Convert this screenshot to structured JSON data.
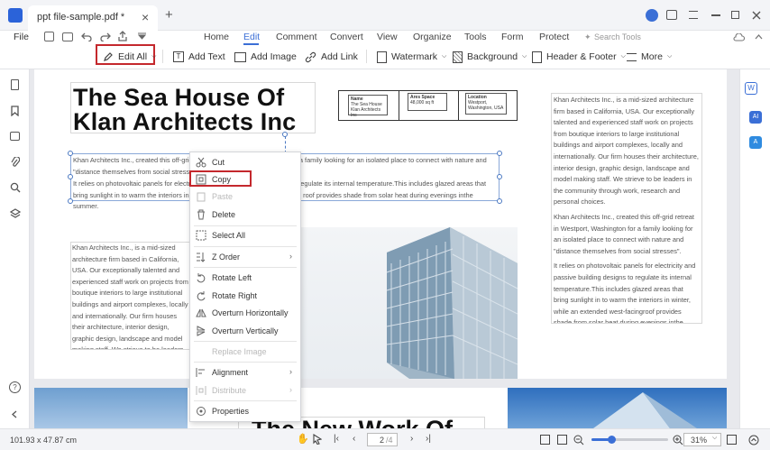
{
  "tab": {
    "title": "ppt file-sample.pdf *",
    "close": "×",
    "new": "+"
  },
  "menu": {
    "file": "File",
    "tabs": [
      "Home",
      "Edit",
      "Comment",
      "Convert",
      "View",
      "Organize",
      "Tools",
      "Form",
      "Protect"
    ],
    "search_placeholder": "Search Tools"
  },
  "toolbar": {
    "edit_all": "Edit All",
    "add_text": "Add Text",
    "add_image": "Add Image",
    "add_link": "Add Link",
    "watermark": "Watermark",
    "background": "Background",
    "header_footer": "Header & Footer",
    "more": "More"
  },
  "page": {
    "heading1": "The Sea House Of",
    "heading1b": "Klan Architects Inc",
    "table_headers": [
      "Name",
      "Ares Space",
      "Location"
    ],
    "table_values": [
      "The Sea House Klan Architects Inc",
      "48,000 sq ft",
      "Westport, Washington, USA"
    ],
    "para_a": "Khan Architects Inc., created this off-grid retreat in Westport, Washington for a family looking for an isolated place to connect with nature and \"distance themselves from social stresses\".",
    "para_b": "It relies on photovoltaic panels for electricity and passive building designs to regulate its internal temperature.This includes glazed areas that bring sunlight in to warm the interiors in winter, while an extended west-facing roof provides shade from solar heat during evenings inthe summer.",
    "para_left": "Khan Architects Inc., is a mid-sized architecture firm based in California, USA. Our exceptionally talented and experienced staff work on projects from boutique interiors to large institutional buildings and airport complexes, locally and internationally. Our firm houses their architecture, interior design, graphic design, landscape and model making staff. We strieve to be leaders in the community through work, research and personal choices.",
    "right_p1": "Khan Architects Inc., is a mid-sized architecture firm based in California, USA. Our exceptionally talented and experienced staff work on projects from boutique interiors to large institutional buildings and airport complexes, locally and internationally. Our firm houses their architecture, interior design, graphic design, landscape and model making staff. We strieve to be leaders in the community through work, research and personal choices.",
    "right_p2": "Khan Architects Inc., created this off-grid retreat in Westport, Washington for a family looking for an isolated place to connect with nature and \"distance themselves from social stresses\".",
    "right_p3": "It relies on photovoltaic panels for electricity and passive building designs to regulate its internal temperature.This includes glazed areas that bring sunlight in to warm the interiors in winter, while an extended west-facingroof provides shade from solar heat during evenings inthe summer.",
    "heading2": "The New Work Of"
  },
  "context_menu": {
    "cut": "Cut",
    "copy": "Copy",
    "paste": "Paste",
    "delete": "Delete",
    "select_all": "Select All",
    "z_order": "Z Order",
    "rotate_left": "Rotate Left",
    "rotate_right": "Rotate Right",
    "overturn_h": "Overturn Horizontally",
    "overturn_v": "Overturn Vertically",
    "replace_image": "Replace Image",
    "alignment": "Alignment",
    "distribute": "Distribute",
    "properties": "Properties"
  },
  "status": {
    "dimensions": "101.93 x 47.87 cm",
    "page_input": "2",
    "page_total": "/4",
    "zoom": "31%"
  },
  "colors": {
    "accent": "#3b6fd6",
    "highlight_box": "#c4282d"
  }
}
